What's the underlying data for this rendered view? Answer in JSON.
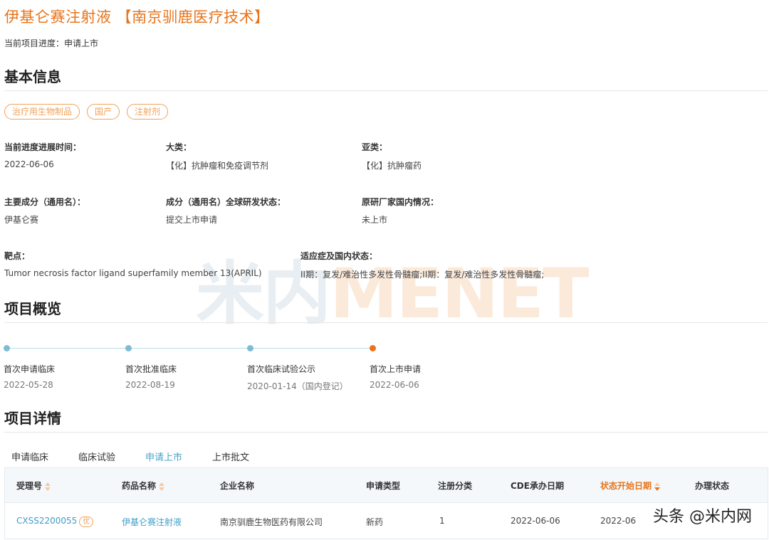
{
  "page": {
    "title": "伊基仑赛注射液 【南京驯鹿医疗技术】",
    "progress": "当前项目进度：申请上市"
  },
  "basic": {
    "heading": "基本信息",
    "tags": [
      "治疗用生物制品",
      "国产",
      "注射剂"
    ],
    "fields": [
      {
        "label": "当前进度进展时间：",
        "value": "2022-06-06"
      },
      {
        "label": "大类：",
        "value": "【化】抗肿瘤和免疫调节剂"
      },
      {
        "label": "亚类：",
        "value": "【化】抗肿瘤药"
      },
      {
        "label": "主要成分（通用名）：",
        "value": "伊基仑赛"
      },
      {
        "label": "成分（通用名）全球研发状态：",
        "value": "提交上市申请"
      },
      {
        "label": "原研厂家国内情况：",
        "value": "未上市"
      },
      {
        "label": "靶点：",
        "value": "Tumor necrosis factor ligand superfamily member 13(APRIL)"
      },
      {
        "label": "适应症及国内状态：",
        "value": "II期：复发/难治性多发性骨髓瘤;II期：复发/难治性多发性骨髓瘤;"
      }
    ]
  },
  "watermark": {
    "cn": "米内",
    "latin": "MENET"
  },
  "overview": {
    "heading": "项目概览",
    "milestones": [
      {
        "name": "首次申请临床",
        "date": "2022-05-28"
      },
      {
        "name": "首次批准临床",
        "date": "2022-08-19"
      },
      {
        "name": "首次临床试验公示",
        "date": "2020-01-14（国内登记）"
      },
      {
        "name": "首次上市申请",
        "date": "2022-06-06"
      }
    ],
    "active_color": "#e8741b",
    "dot_color": "#7dbcd6"
  },
  "details": {
    "heading": "项目详情",
    "tabs": [
      "申请临床",
      "临床试验",
      "申请上市",
      "上市批文"
    ],
    "active_tab": "申请上市",
    "columns": [
      "受理号",
      "药品名称",
      "企业名称",
      "申请类型",
      "注册分类",
      "CDE承办日期",
      "状态开始日期",
      "办理状态"
    ],
    "rows": [
      {
        "accept_no": "CXSS2200055",
        "badge": "优",
        "drug": "伊基仑赛注射液",
        "company": "南京驯鹿生物医药有限公司",
        "app_type": "新药",
        "reg_class": "1",
        "cde_date": "2022-06-06",
        "status_date": "2022-06",
        "status": ""
      }
    ]
  },
  "footer_watermark": "头条 @米内网",
  "colors": {
    "accent": "#e8741b",
    "link": "#3d9cc7",
    "tag": "#f0a25a"
  }
}
